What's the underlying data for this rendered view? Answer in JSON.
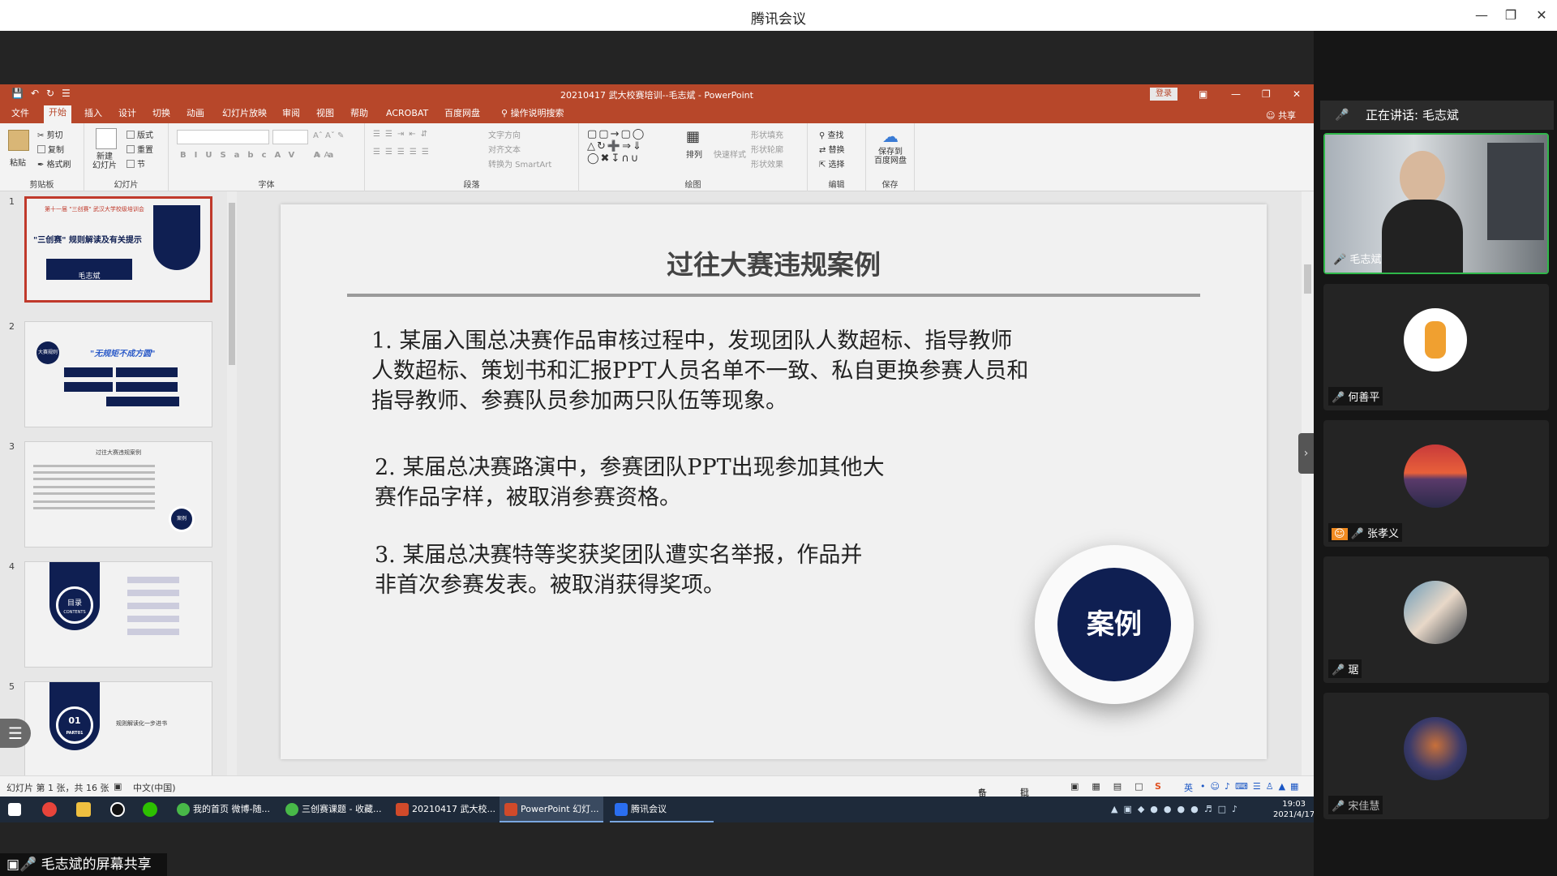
{
  "app": {
    "title": "腾讯会议",
    "share_label": "毛志斌的屏幕共享"
  },
  "ppt": {
    "doc_title": "20210417 武大校赛培训--毛志斌 - PowerPoint",
    "login": "登录",
    "tabs": [
      "文件",
      "开始",
      "插入",
      "设计",
      "切换",
      "动画",
      "幻灯片放映",
      "审阅",
      "视图",
      "帮助",
      "ACROBAT",
      "百度网盘",
      "操作说明搜索"
    ],
    "active_tab": "开始",
    "share": "共享",
    "ribbon": {
      "clipboard": {
        "label": "剪贴板",
        "paste": "粘贴",
        "cut": "剪切",
        "copy": "复制",
        "format": "格式刷"
      },
      "slides": {
        "label": "幻灯片",
        "new": "新建\n幻灯片",
        "layout": "版式",
        "reset": "重置",
        "section": "节"
      },
      "font": {
        "label": "字体"
      },
      "paragraph": {
        "label": "段落",
        "direction": "文字方向",
        "align": "对齐文本",
        "smartart": "转换为 SmartArt"
      },
      "drawing": {
        "label": "绘图",
        "arrange": "排列",
        "quick_styles": "快速样式",
        "fill": "形状填充",
        "outline": "形状轮廓",
        "effects": "形状效果"
      },
      "editing": {
        "label": "编辑",
        "find": "查找",
        "replace": "替换",
        "select": "选择"
      },
      "save": {
        "label": "保存",
        "baidu": "保存到\n百度网盘"
      }
    },
    "thumbnails": [
      {
        "num": "1",
        "title": "\"三创赛\" 规则解读及有关提示",
        "header": "第十一届 \"三创赛\" 武汉大学校级培训会",
        "speaker": "毛志斌"
      },
      {
        "num": "2",
        "title": "\"无规矩不成方圆\"",
        "badge": "大赛规则"
      },
      {
        "num": "3",
        "title": "过往大赛违规案例",
        "badge": "案例"
      },
      {
        "num": "4",
        "title": "目录",
        "subtitle": "CONTENTS"
      },
      {
        "num": "5",
        "title": "01",
        "subtitle": "PART01",
        "line": "规则解读化一步进书"
      }
    ],
    "slide": {
      "title": "过往大赛违规案例",
      "case1": [
        "1. 某届入围总决赛作品审核过程中，发现团队人数超标、指导教师",
        "人数超标、策划书和汇报PPT人员名单不一致、私自更换参赛人员和",
        "指导教师、参赛队员参加两只队伍等现象。"
      ],
      "case2": [
        "2. 某届总决赛路演中，参赛团队PPT出现参加其他大",
        "赛作品字样，被取消参赛资格。"
      ],
      "case3": [
        "3. 某届总决赛特等奖获奖团队遭实名举报，作品并",
        "非首次参赛发表。被取消获得奖项。"
      ],
      "badge": "案例"
    },
    "status": {
      "slide_count": "幻灯片 第 1 张，共 16 张",
      "language": "中文(中国)",
      "notes": "备注",
      "comments": "批注"
    }
  },
  "taskbar": {
    "items": [
      "我的首页 微博-随...",
      "三创赛课题 - 收藏...",
      "20210417 武大校...",
      "PowerPoint 幻灯...",
      "腾讯会议"
    ],
    "time": "19:03",
    "date": "2021/4/17",
    "ime": "英"
  },
  "panel": {
    "speaking": "正在讲话: 毛志斌",
    "participants": [
      {
        "name": "毛志斌",
        "video": true
      },
      {
        "name": "何善平"
      },
      {
        "name": "张孝义"
      },
      {
        "name": "琚"
      },
      {
        "name": "宋佳慧"
      }
    ]
  }
}
